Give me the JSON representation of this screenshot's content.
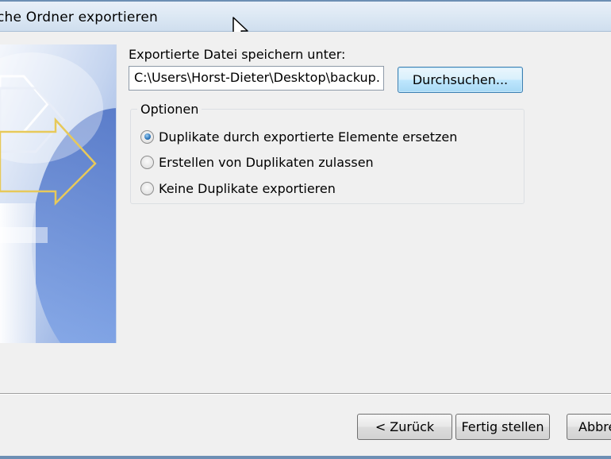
{
  "window": {
    "title": "che Ordner exportieren"
  },
  "form": {
    "save_label": "Exportierte Datei speichern unter:",
    "path_value": "C:\\Users\\Horst-Dieter\\Desktop\\backup.",
    "browse_label": "Durchsuchen..."
  },
  "options": {
    "legend": "Optionen",
    "items": [
      {
        "label": "Duplikate durch exportierte Elemente ersetzen",
        "checked": true
      },
      {
        "label": "Erstellen von Duplikaten zulassen",
        "checked": false
      },
      {
        "label": "Keine Duplikate exportieren",
        "checked": false
      }
    ]
  },
  "footer": {
    "back_label": "< Zurück",
    "finish_label": "Fertig stellen",
    "cancel_label": "Abbre"
  },
  "colors": {
    "titlebar": "#dce8f4",
    "accent": "#3c7fb1",
    "dialog_bg": "#f0f0f0"
  }
}
